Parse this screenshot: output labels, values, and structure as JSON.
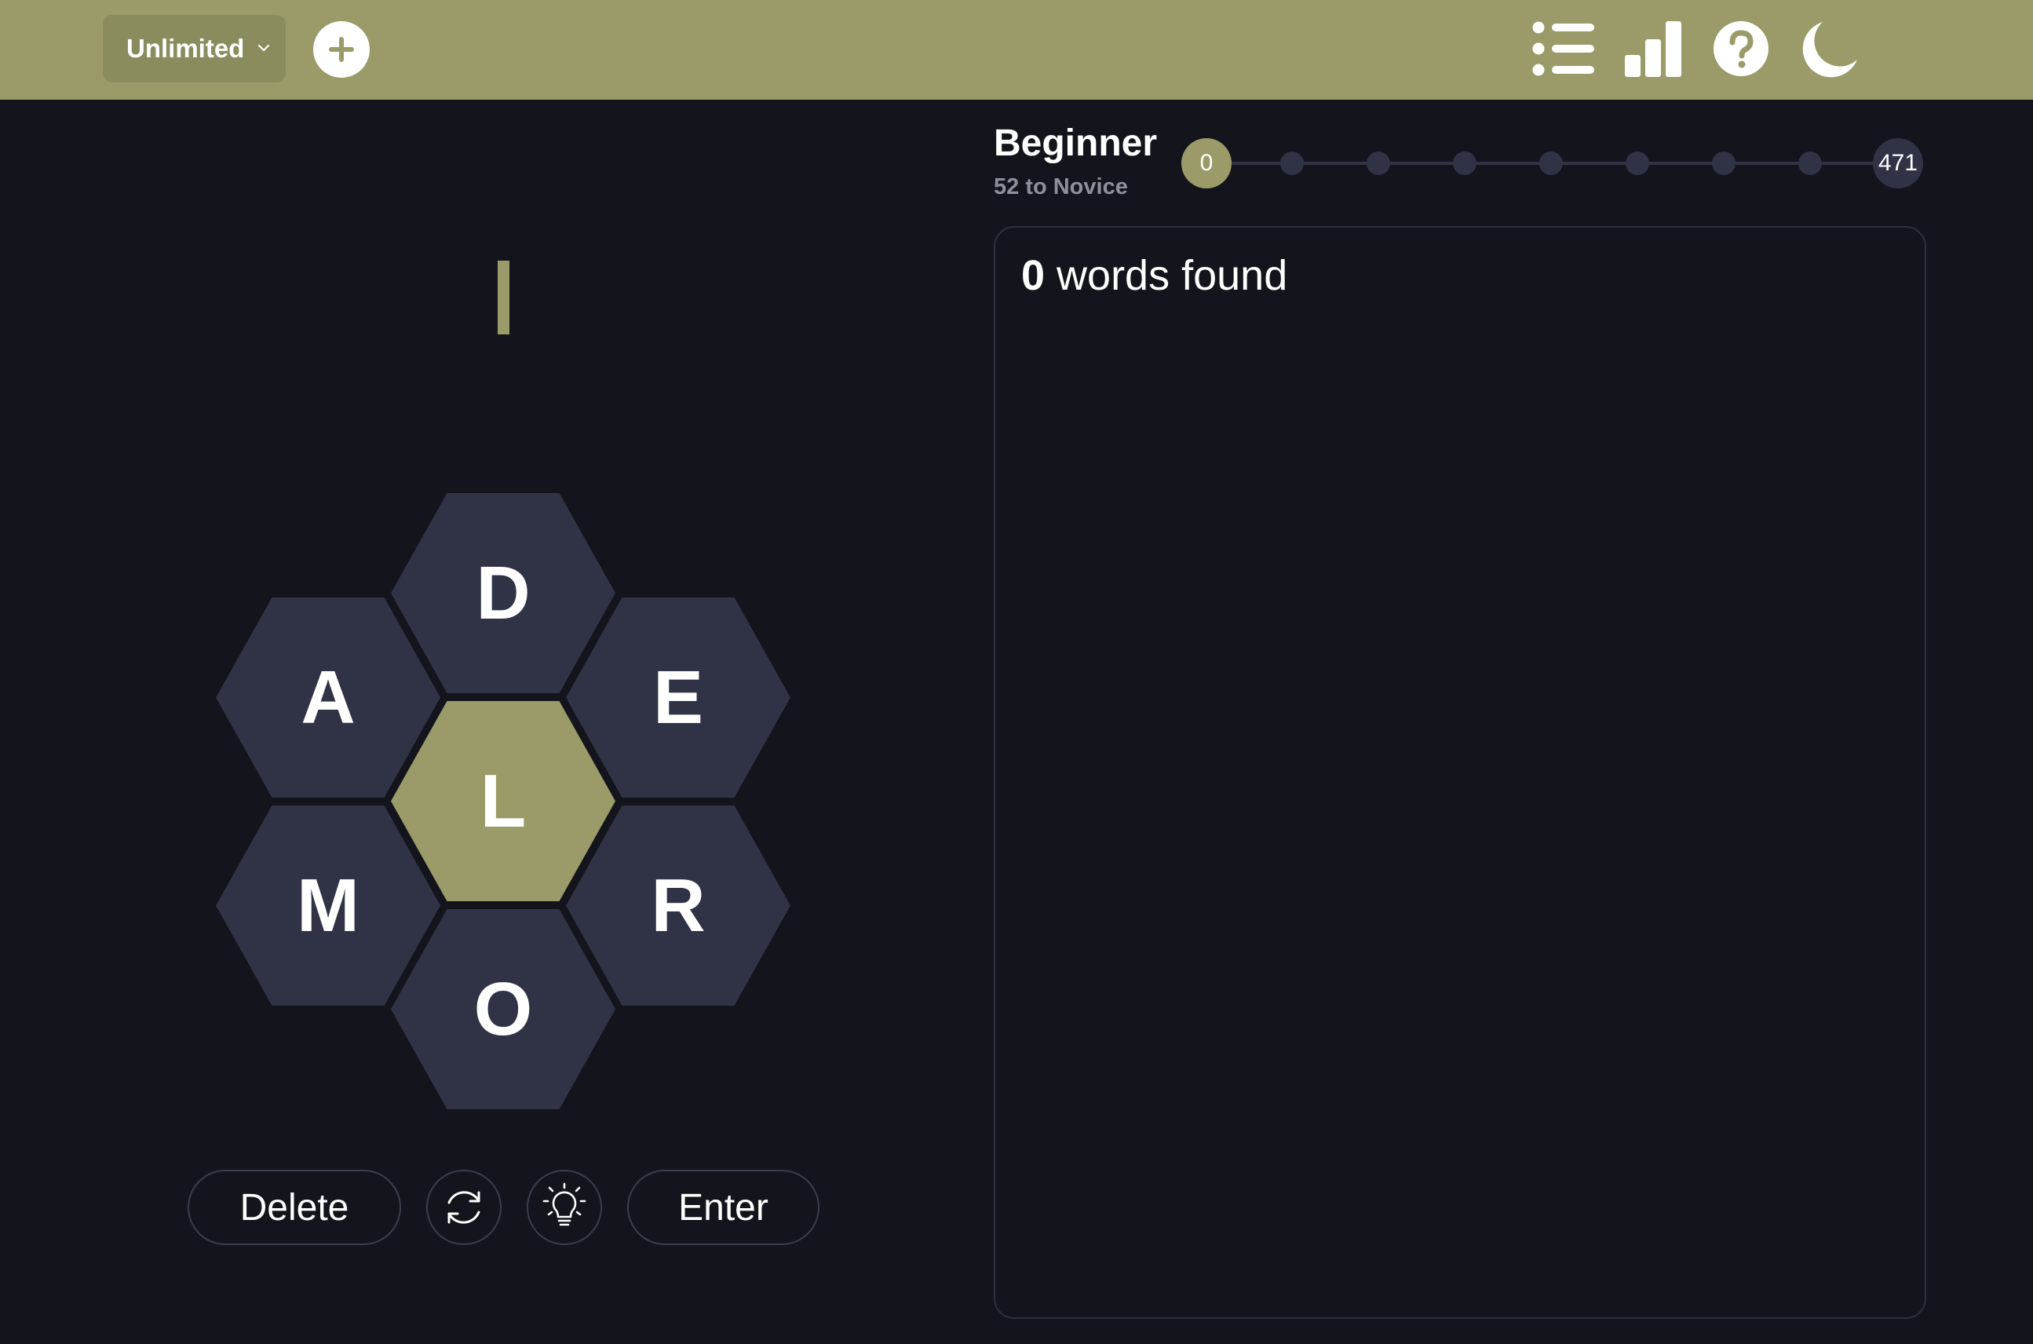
{
  "header": {
    "mode_label": "Unlimited",
    "icons": {
      "add": "plus-circle-icon",
      "list": "list-icon",
      "stats": "bar-chart-icon",
      "help": "question-circle-icon",
      "theme": "moon-icon"
    },
    "colors": {
      "accent": "#9a9b68",
      "background": "#13141c",
      "tile": "#303346"
    }
  },
  "puzzle": {
    "center_letter": "L",
    "outer_letters": {
      "top": "D",
      "upper_left": "A",
      "upper_right": "E",
      "lower_left": "M",
      "lower_right": "R",
      "bottom": "O"
    },
    "current_word": ""
  },
  "controls": {
    "delete_label": "Delete",
    "enter_label": "Enter",
    "shuffle_icon": "shuffle-icon",
    "hint_icon": "lightbulb-icon"
  },
  "rank": {
    "title": "Beginner",
    "subtitle": "52 to Novice",
    "score": "0",
    "max_score": "471",
    "progress_fraction": 0
  },
  "words": {
    "count": "0",
    "label": " words found"
  }
}
